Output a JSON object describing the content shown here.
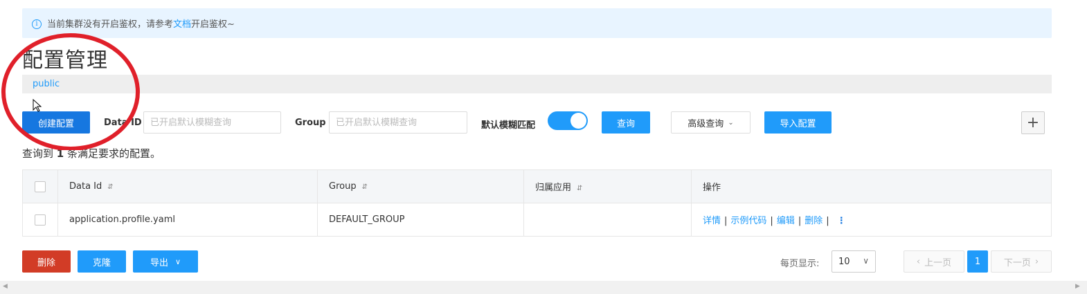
{
  "notice": {
    "text_before": "当前集群没有开启鉴权，请参考",
    "link": "文档",
    "text_after": "开启鉴权~"
  },
  "page_title": "配置管理",
  "namespace": "public",
  "toolbar": {
    "create_label": "创建配置",
    "data_id_label": "Data ID",
    "data_id_placeholder": "已开启默认模糊查询",
    "group_label": "Group",
    "group_placeholder": "已开启默认模糊查询",
    "fuzzy_label": "默认模糊匹配",
    "fuzzy_on": true,
    "query_label": "查询",
    "advanced_label": "高级查询",
    "import_label": "导入配置",
    "plus_label": "+"
  },
  "result": {
    "prefix": "查询到",
    "count": "1",
    "suffix": "条满足要求的配置。"
  },
  "table": {
    "headers": [
      "Data Id",
      "Group",
      "归属应用",
      "操作"
    ],
    "rows": [
      {
        "data_id": "application.profile.yaml",
        "group": "DEFAULT_GROUP",
        "app": "",
        "ops": [
          "详情",
          "示例代码",
          "编辑",
          "删除"
        ]
      }
    ]
  },
  "bottom": {
    "delete_label": "删除",
    "clone_label": "克隆",
    "export_label": "导出",
    "page_size_label": "每页显示:",
    "page_size": "10",
    "prev_label": "上一页",
    "current_page": "1",
    "next_label": "下一页"
  },
  "colors": {
    "primary": "#209bfa",
    "danger": "#d23c26",
    "annotation": "#e0202a"
  },
  "icons": [
    "info-icon",
    "sort-icon",
    "chevron-down-icon",
    "more-vertical-icon",
    "plus-icon",
    "chevron-left-icon",
    "chevron-right-icon",
    "cursor-icon"
  ]
}
